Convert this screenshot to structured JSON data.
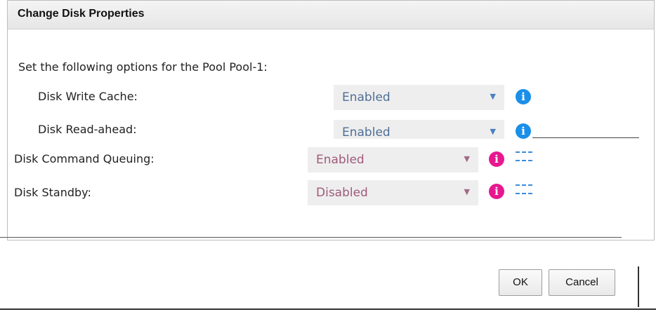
{
  "dialog": {
    "title": "Change Disk Properties",
    "intro": "Set the following options for the Pool Pool-1:",
    "fields": [
      {
        "label": "Disk Write Cache:",
        "value": "Enabled",
        "info_icon": "info-icon"
      },
      {
        "label": "Disk Read-ahead:",
        "value": "Enabled",
        "info_icon": "info-icon"
      },
      {
        "label": "Disk Command Queuing:",
        "value": "Enabled",
        "info_icon": "info-icon"
      },
      {
        "label": "Disk Standby:",
        "value": "Disabled",
        "info_icon": "info-icon"
      }
    ],
    "ok_label": "OK",
    "cancel_label": "Cancel"
  },
  "icons": {
    "dropdown": "chevron-down-icon",
    "info_glyph": "i"
  },
  "colors": {
    "info_blue": "#1a8fe8",
    "info_pink": "#e8178f",
    "select_bg": "#eeeeee",
    "title_bar": "#ececec"
  }
}
